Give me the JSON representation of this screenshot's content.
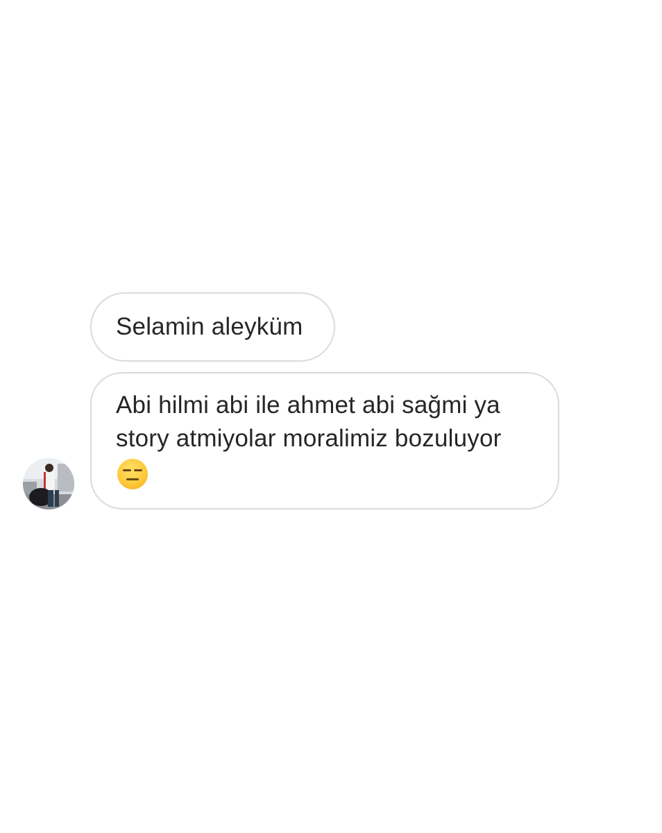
{
  "thread": {
    "messages": [
      {
        "text": "Selamin aleyküm"
      },
      {
        "lines": [
          "Abi hilmi abi ile ahmet abi sağmi ya",
          "story atmiyolar moralimiz bozuluyor"
        ],
        "emoji": "expressionless-face-icon"
      }
    ],
    "sender": {
      "avatar": "profile-photo"
    }
  },
  "colors": {
    "background": "#ffffff",
    "bubble_border": "#dbdbdb",
    "text": "#262626"
  }
}
